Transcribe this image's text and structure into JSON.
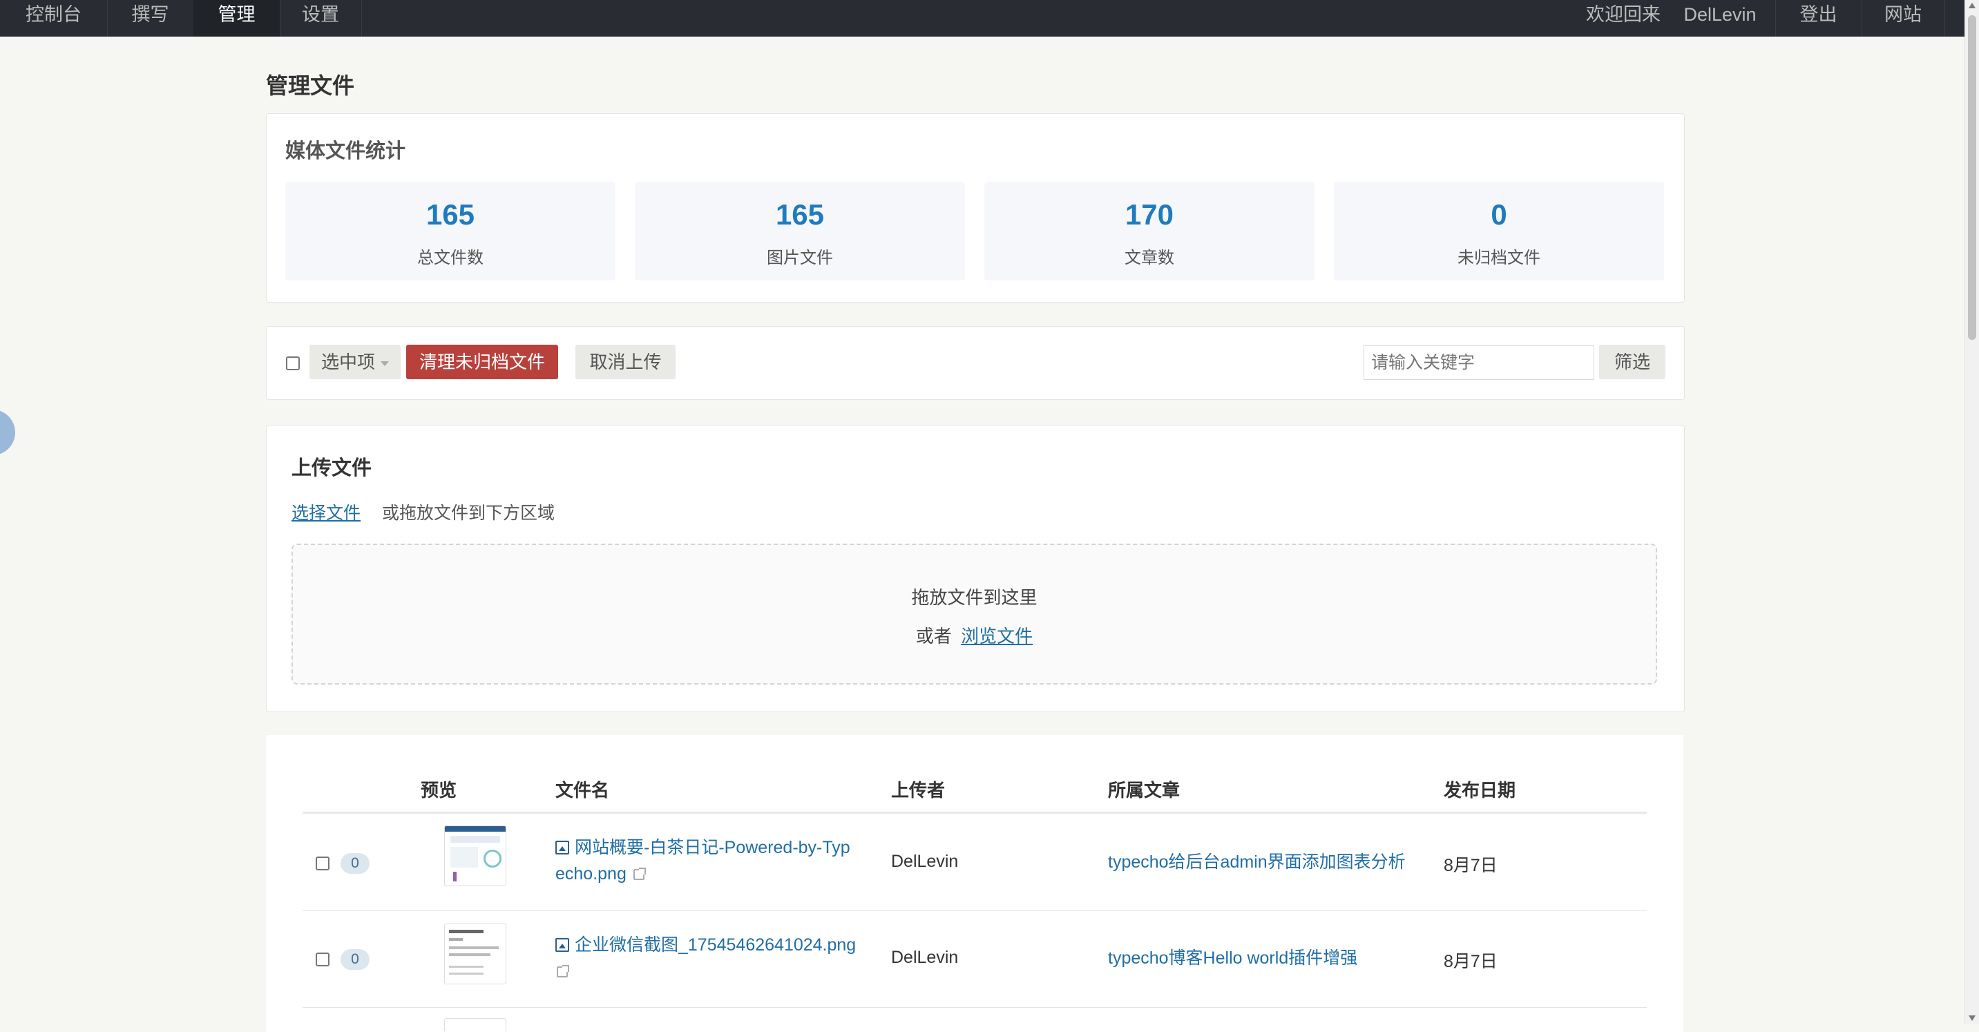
{
  "nav": {
    "items": [
      {
        "label": "控制台"
      },
      {
        "label": "撰写"
      },
      {
        "label": "管理",
        "active": true
      },
      {
        "label": "设置"
      }
    ],
    "welcome": "欢迎回来",
    "user": "DelLevin",
    "logout": "登出",
    "site": "网站"
  },
  "page": {
    "title": "管理文件"
  },
  "stats": {
    "title": "媒体文件统计",
    "cards": [
      {
        "value": "165",
        "label": "总文件数"
      },
      {
        "value": "165",
        "label": "图片文件"
      },
      {
        "value": "170",
        "label": "文章数"
      },
      {
        "value": "0",
        "label": "未归档文件"
      }
    ]
  },
  "toolbar": {
    "select_label": "选中项",
    "clean_label": "清理未归档文件",
    "cancel_label": "取消上传",
    "search_placeholder": "请输入关键字",
    "filter_label": "筛选"
  },
  "upload": {
    "title": "上传文件",
    "choose_label": "选择文件",
    "hint": "或拖放文件到下方区域",
    "drop_text": "拖放文件到这里",
    "or_text": "或者",
    "browse_label": "浏览文件"
  },
  "table": {
    "headers": {
      "preview": "预览",
      "filename": "文件名",
      "uploader": "上传者",
      "article": "所属文章",
      "date": "发布日期"
    },
    "rows": [
      {
        "count": "0",
        "filename": "网站概要-白茶日记-Powered-by-Typecho.png",
        "filename_line1": "网站概要-白茶日记-Powered-by-Typ",
        "filename_line2": "echo.png",
        "uploader": "DelLevin",
        "article": "typecho给后台admin界面添加图表分析",
        "date": "8月7日"
      },
      {
        "count": "0",
        "filename": "企业微信截图_17545462641024.png",
        "filename_line1": "企业微信截图_17545462641024.png",
        "filename_line2": "",
        "uploader": "DelLevin",
        "article": "typecho博客Hello world插件增强",
        "date": "8月7日"
      }
    ]
  },
  "colors": {
    "topbar": "#292d33",
    "accent": "#1f7bc0",
    "danger": "#b9413c",
    "link": "#1f6ea8"
  }
}
